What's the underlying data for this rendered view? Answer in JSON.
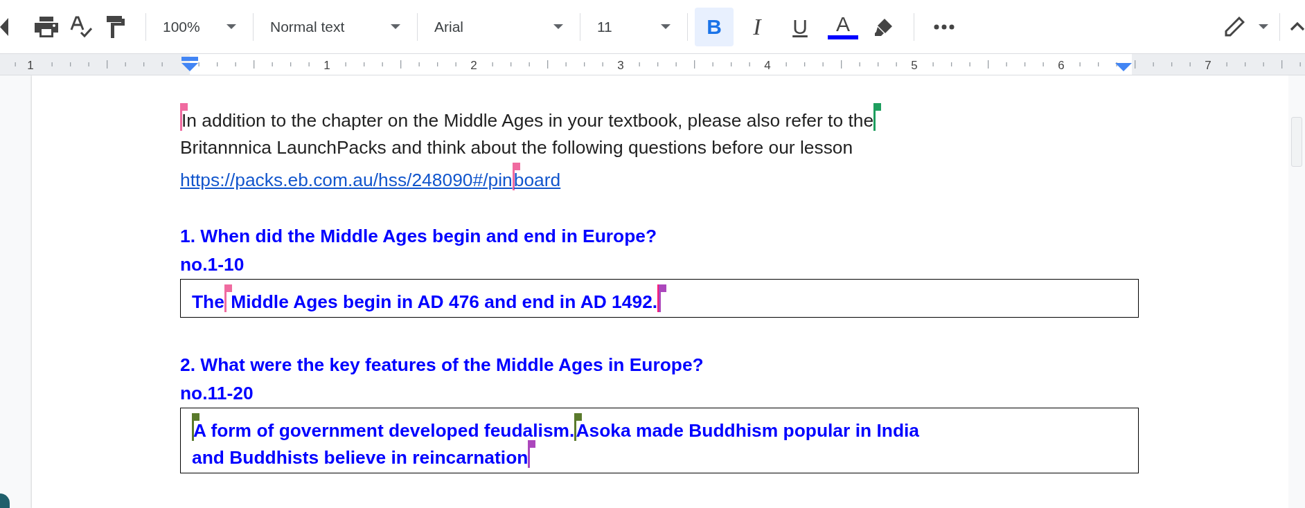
{
  "toolbar": {
    "zoom": "100%",
    "style": "Normal text",
    "font": "Arial",
    "size": "11",
    "format_buttons": [
      {
        "kind": "bold",
        "glyph": "B",
        "selected": true
      },
      {
        "kind": "italic",
        "glyph": "I",
        "selected": false
      },
      {
        "kind": "underline",
        "glyph": "U",
        "selected": false
      },
      {
        "kind": "text_color",
        "glyph": "A",
        "selected": false,
        "color": "#0000ff"
      }
    ]
  },
  "ruler": {
    "labels": [
      "1",
      "1",
      "2",
      "3",
      "4",
      "5",
      "6",
      "7"
    ]
  },
  "document": {
    "blocks": [
      {
        "kind": "paragraph",
        "lines": [
          [
            {
              "kind": "cursor",
              "color": "#f06ba0"
            },
            {
              "kind": "text",
              "text": "In addition to the chapter on the Middle Ages in your textbook, please also refer to the"
            },
            {
              "kind": "cursor",
              "color": "#1e9e5e"
            }
          ],
          [
            {
              "kind": "text",
              "text": "Britannnica LaunchPacks and think about the following questions before our lesson"
            }
          ],
          [
            {
              "kind": "link",
              "text": "https://packs.eb.com.au/hss/248090#/pin"
            },
            {
              "kind": "cursor",
              "color": "#f06ba0"
            },
            {
              "kind": "link",
              "text": "board"
            }
          ]
        ]
      },
      {
        "kind": "heading",
        "text": "1. When did the Middle Ages begin and end in Europe?"
      },
      {
        "kind": "label",
        "text": "no.1-10"
      },
      {
        "kind": "answer",
        "lines": [
          [
            {
              "kind": "text",
              "text": "The"
            },
            {
              "kind": "cursor",
              "color": "#f06ba0"
            },
            {
              "kind": "text",
              "text": " Middle Ages begin in AD 476 and end in AD 1492."
            },
            {
              "kind": "cursor",
              "color": "#ff1a75"
            },
            {
              "kind": "cursor",
              "color": "#ab47bc"
            }
          ]
        ]
      },
      {
        "kind": "heading",
        "text": "2. What were the key features of the Middle Ages in Europe?"
      },
      {
        "kind": "label",
        "text": "no.11-20"
      },
      {
        "kind": "answer",
        "lines": [
          [
            {
              "kind": "cursor",
              "color": "#5a7a2c"
            },
            {
              "kind": "text",
              "text": "A form of government developed feudalism."
            },
            {
              "kind": "cursor",
              "color": "#5a7a2c"
            },
            {
              "kind": "text",
              "text": "Asoka made Buddhism popular in India"
            }
          ],
          [
            {
              "kind": "text",
              "text": "and Buddhists believe in reincarnation"
            },
            {
              "kind": "cursor",
              "color": "#ab47bc"
            }
          ]
        ]
      }
    ]
  }
}
